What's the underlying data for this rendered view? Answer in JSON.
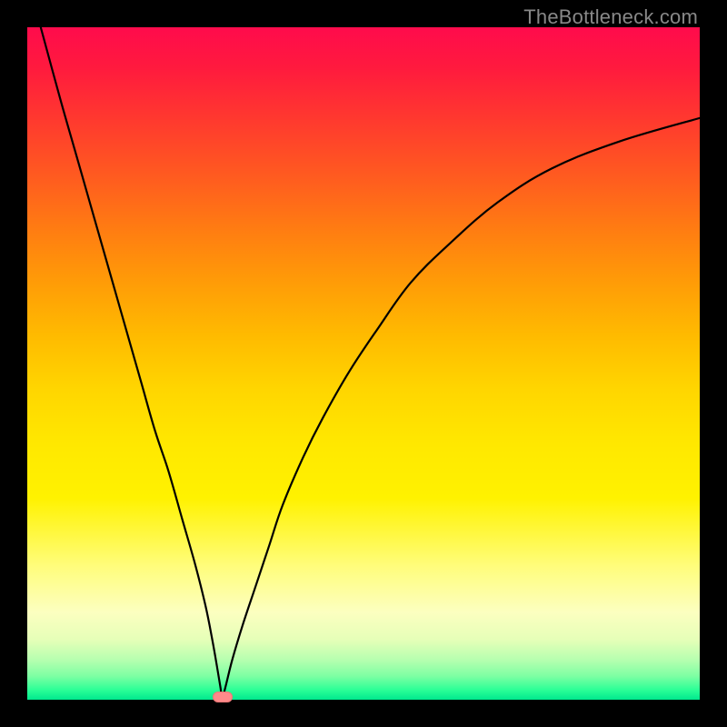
{
  "watermark": "TheBottleneck.com",
  "chart_data": {
    "type": "line",
    "title": "",
    "xlabel": "",
    "ylabel": "",
    "xlim": [
      0,
      100
    ],
    "ylim": [
      0,
      100
    ],
    "series": [
      {
        "name": "bottleneck-curve",
        "x": [
          2,
          5,
          7,
          9,
          11,
          13,
          15,
          17,
          19,
          21,
          23,
          25,
          26.5,
          27.5,
          28.2,
          28.7,
          29,
          29.5,
          30.5,
          32,
          34,
          36,
          38,
          41,
          44,
          48,
          52,
          57,
          63,
          70,
          78,
          88,
          100
        ],
        "y": [
          100,
          89,
          82,
          75,
          68,
          61,
          54,
          47,
          40,
          34,
          27,
          20,
          14,
          9,
          5,
          2,
          0.4,
          2,
          6,
          11,
          17,
          23,
          29,
          36,
          42,
          49,
          55,
          62,
          68,
          74,
          79,
          83,
          86.5
        ]
      }
    ],
    "marker": {
      "x": 29,
      "y": 0.4
    },
    "gradient_bands": [
      {
        "y": 100,
        "color": "#ff0b4c"
      },
      {
        "y": 50,
        "color": "#ffd600"
      },
      {
        "y": 10,
        "color": "#fcffc0"
      },
      {
        "y": 0,
        "color": "#00e88e"
      }
    ]
  }
}
